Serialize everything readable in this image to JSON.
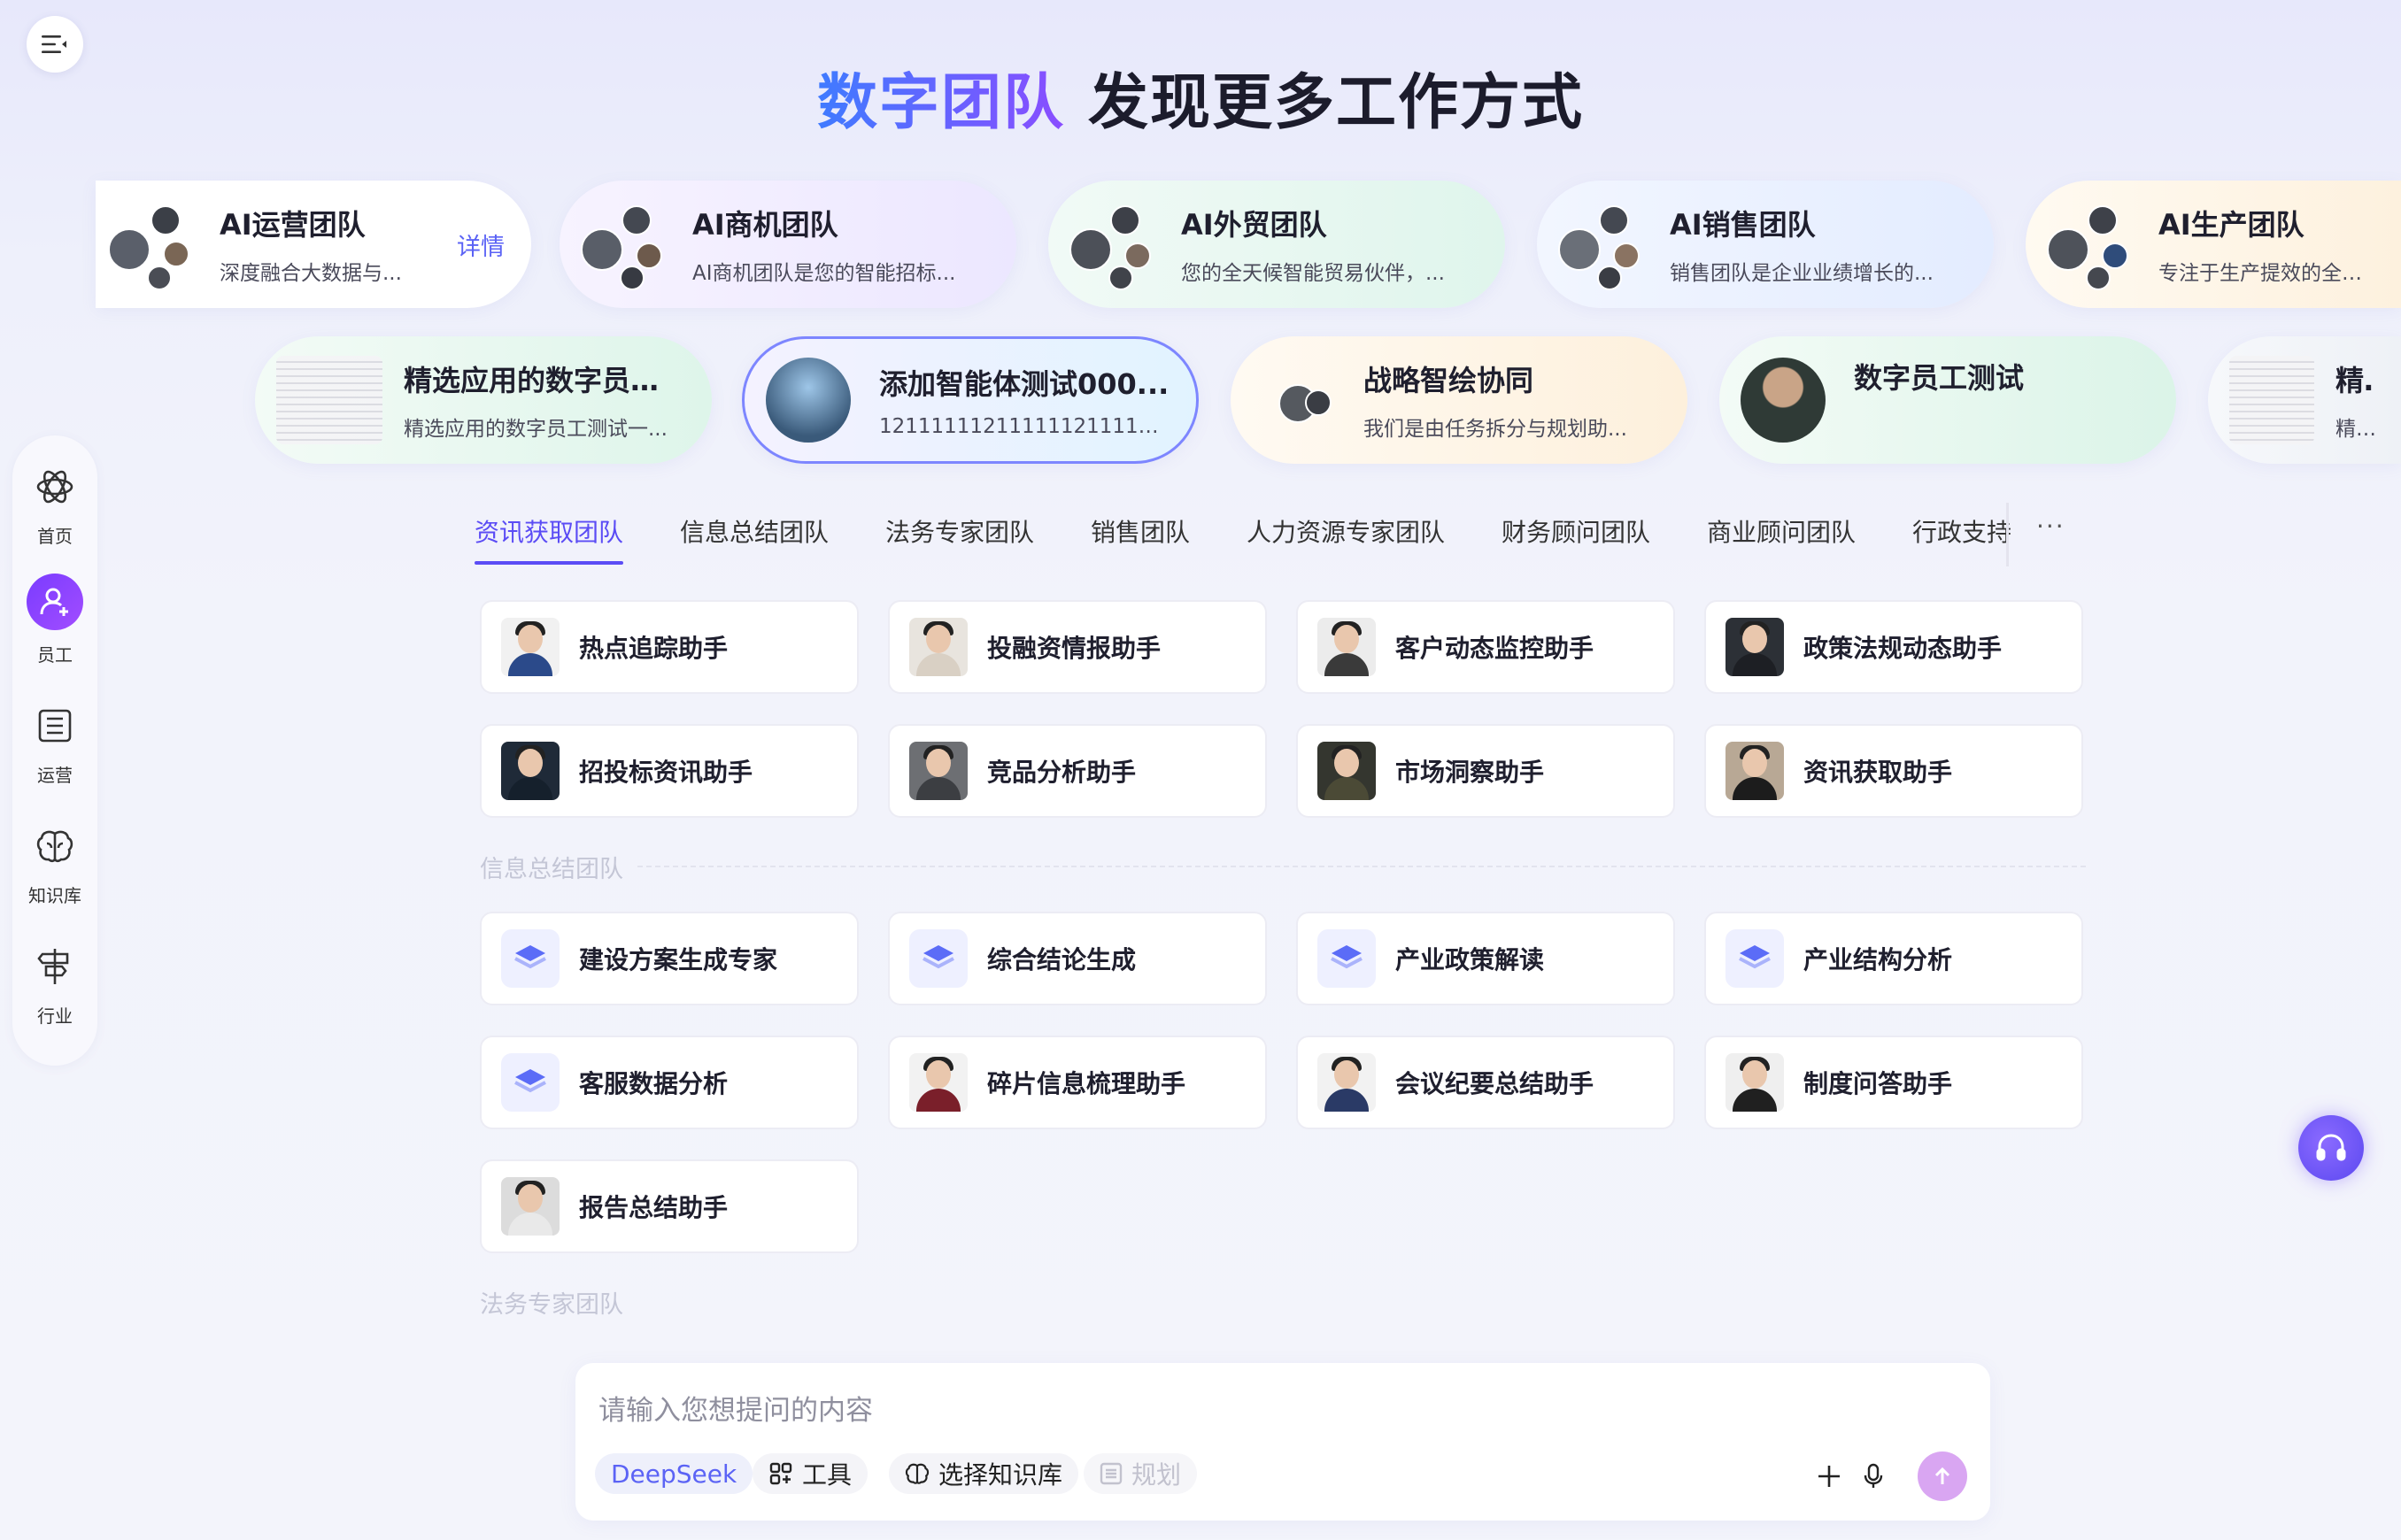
{
  "header": {
    "title_accent": "数字团队",
    "title_rest": "发现更多工作方式"
  },
  "team_row1": [
    {
      "name": "AI运营团队",
      "desc": "深度融合大数据与...",
      "detail": "详情"
    },
    {
      "name": "AI商机团队",
      "desc": "AI商机团队是您的智能招标..."
    },
    {
      "name": "AI外贸团队",
      "desc": "您的全天候智能贸易伙伴，..."
    },
    {
      "name": "AI销售团队",
      "desc": "销售团队是企业业绩增长的..."
    },
    {
      "name": "AI生产团队",
      "desc": "专注于生产提效的全链路"
    }
  ],
  "team_row2": [
    {
      "name": "精选应用的数字员工...",
      "desc": "精选应用的数字员工测试一..."
    },
    {
      "name": "添加智能体测试000...",
      "desc": "1211111121111112111111211111..."
    },
    {
      "name": "战略智绘协同",
      "desc": "我们是由任务拆分与规划助..."
    },
    {
      "name": "数字员工测试",
      "desc": ""
    },
    {
      "name": "精选",
      "desc": "精选"
    }
  ],
  "sidebar": [
    {
      "label": "首页",
      "icon": "home-atom-icon"
    },
    {
      "label": "员工",
      "icon": "add-user-icon"
    },
    {
      "label": "运营",
      "icon": "list-icon"
    },
    {
      "label": "知识库",
      "icon": "brain-icon"
    },
    {
      "label": "行业",
      "icon": "signpost-icon"
    }
  ],
  "tabs": [
    "资讯获取团队",
    "信息总结团队",
    "法务专家团队",
    "销售团队",
    "人力资源专家团队",
    "财务顾问团队",
    "商业顾问团队",
    "行政支持"
  ],
  "tabs_more": "···",
  "section1": [
    "热点追踪助手",
    "投融资情报助手",
    "客户动态监控助手",
    "政策法规动态助手",
    "招投标资讯助手",
    "竞品分析助手",
    "市场洞察助手",
    "资讯获取助手"
  ],
  "section2_label": "信息总结团队",
  "section2": [
    "建设方案生成专家",
    "综合结论生成",
    "产业政策解读",
    "产业结构分析",
    "客服数据分析",
    "碎片信息梳理助手",
    "会议纪要总结助手",
    "制度问答助手",
    "报告总结助手"
  ],
  "section3_label": "法务专家团队",
  "input": {
    "placeholder": "请输入您想提问的内容",
    "model": "DeepSeek",
    "tools": "工具",
    "knowledge": "选择知识库",
    "plan": "规划"
  },
  "colors": {
    "accent": "#5b4cf5",
    "brand_gradient": [
      "#3f7bff",
      "#8a4dff"
    ]
  }
}
